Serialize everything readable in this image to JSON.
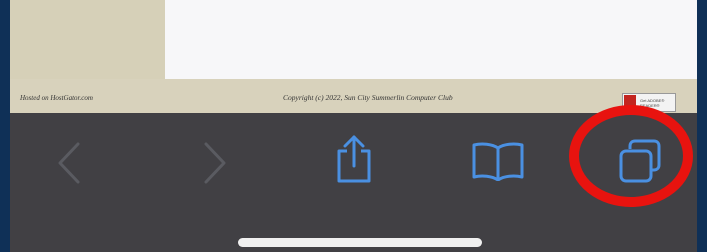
{
  "footer": {
    "hosted_text": "Hosted on HostGator.com",
    "copyright_text": "Copyright (c) 2022, Sun City Summerlin Computer Club",
    "badge_text": "Get  ADOBE® READER®"
  },
  "toolbar": {
    "items": [
      {
        "id": "back",
        "icon": "chevron-left-icon",
        "state": "disabled"
      },
      {
        "id": "forward",
        "icon": "chevron-right-icon",
        "state": "disabled"
      },
      {
        "id": "share",
        "icon": "share-icon",
        "state": "enabled"
      },
      {
        "id": "bookmarks",
        "icon": "open-book-icon",
        "state": "enabled"
      },
      {
        "id": "tabs",
        "icon": "tabs-icon",
        "state": "enabled"
      }
    ],
    "colors": {
      "enabled": "#4a90e2",
      "disabled": "#5a5b61",
      "background": "#414044"
    }
  },
  "annotation": {
    "color": "#e8130f",
    "target": "tabs"
  }
}
